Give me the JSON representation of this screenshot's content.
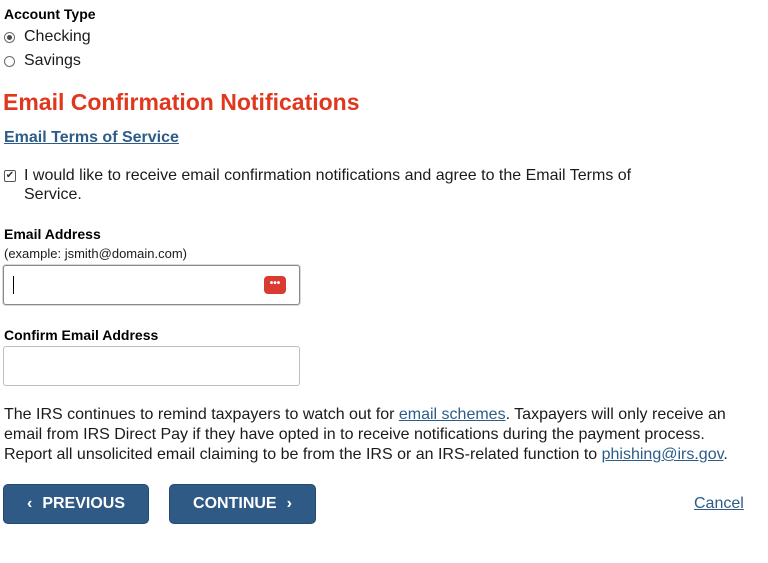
{
  "account_type": {
    "label": "Account Type",
    "options": [
      {
        "label": "Checking",
        "selected": true
      },
      {
        "label": "Savings",
        "selected": false
      }
    ]
  },
  "email_section": {
    "heading": "Email Confirmation Notifications",
    "terms_link": "Email Terms of Service",
    "agree_checked": true,
    "agree_line1": "I would like to receive email confirmation notifications and agree to the Email Terms of",
    "agree_line2": "Service."
  },
  "email_field": {
    "label": "Email Address",
    "hint": "(example: jsmith@domain.com)",
    "value": "",
    "icon": "password-manager-icon",
    "icon_glyph": "•••"
  },
  "confirm_field": {
    "label": "Confirm Email Address",
    "value": ""
  },
  "info": {
    "part1": "The IRS continues to remind taxpayers to watch out for ",
    "link1": "email schemes",
    "part2": ". Taxpayers will only receive an",
    "line2": "email from IRS Direct Pay if they have opted in to receive notifications during the payment process.",
    "line3": "Report all unsolicited email claiming to be from the IRS or an IRS-related function to ",
    "link2": "phishing@irs.gov",
    "line3_end": "."
  },
  "buttons": {
    "previous": "PREVIOUS",
    "continue": "CONTINUE",
    "cancel": "Cancel",
    "prev_chevron": "‹",
    "next_chevron": "›"
  },
  "colors": {
    "heading": "#e0371d",
    "link": "#2d5c88",
    "button": "#305a86"
  }
}
